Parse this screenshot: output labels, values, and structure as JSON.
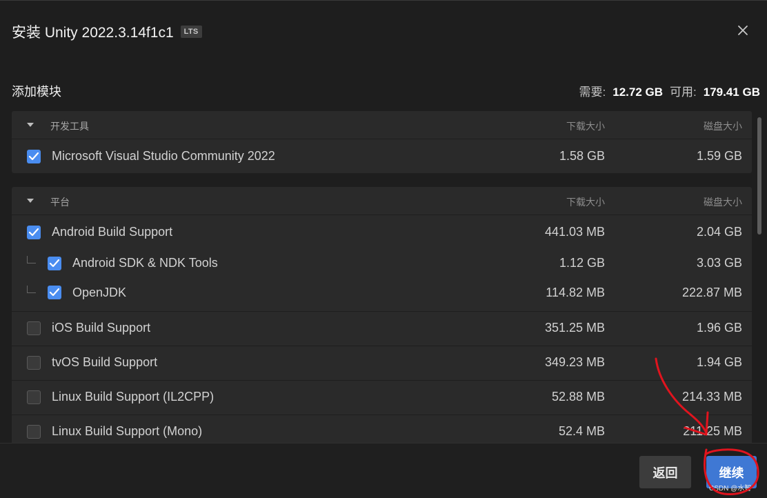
{
  "dialog": {
    "title": "安装 Unity 2022.3.14f1c1",
    "badge": "LTS"
  },
  "modules": {
    "heading": "添加模块",
    "required_label": "需要:",
    "required_value": "12.72 GB",
    "available_label": "可用:",
    "available_value": "179.41 GB"
  },
  "groups": [
    {
      "name": "开发工具",
      "col_download": "下载大小",
      "col_disk": "磁盘大小",
      "items": [
        {
          "label": "Microsoft Visual Studio Community 2022",
          "download": "1.58 GB",
          "disk": "1.59 GB",
          "checked": true
        }
      ]
    },
    {
      "name": "平台",
      "col_download": "下载大小",
      "col_disk": "磁盘大小",
      "items": [
        {
          "label": "Android Build Support",
          "download": "441.03 MB",
          "disk": "2.04 GB",
          "checked": true
        },
        {
          "label": "Android SDK & NDK Tools",
          "download": "1.12 GB",
          "disk": "3.03 GB",
          "checked": true,
          "child": true
        },
        {
          "label": "OpenJDK",
          "download": "114.82 MB",
          "disk": "222.87 MB",
          "checked": true,
          "child": true
        },
        {
          "label": "iOS Build Support",
          "download": "351.25 MB",
          "disk": "1.96 GB",
          "checked": false
        },
        {
          "label": "tvOS Build Support",
          "download": "349.23 MB",
          "disk": "1.94 GB",
          "checked": false
        },
        {
          "label": "Linux Build Support (IL2CPP)",
          "download": "52.88 MB",
          "disk": "214.33 MB",
          "checked": false
        },
        {
          "label": "Linux Build Support (Mono)",
          "download": "52.4 MB",
          "disk": "211.25 MB",
          "checked": false
        }
      ]
    }
  ],
  "footer": {
    "back_label": "返回",
    "continue_label": "继续",
    "watermark": "CSDN @水智"
  },
  "colors": {
    "accent": "#4a8df0",
    "primary_button": "#3f78d4",
    "annotation": "#e0141e"
  }
}
